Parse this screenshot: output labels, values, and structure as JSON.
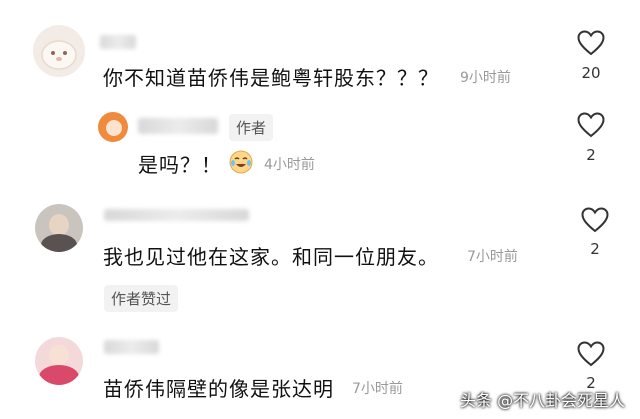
{
  "comments": [
    {
      "text": "你不知道苗侨伟是鲍粤轩股东？？？",
      "time": "9小时前",
      "likes": "20"
    },
    {
      "text": "我也见过他在这家。和同一位朋友。",
      "time": "7小时前",
      "likes": "2",
      "badge": "作者赞过"
    },
    {
      "text": "苗侨伟隔壁的像是张达明",
      "time": "7小时前",
      "likes": "2"
    }
  ],
  "reply": {
    "author_tag": "作者",
    "text": "是吗？！",
    "time": "4小时前",
    "likes": "2"
  },
  "watermark": {
    "text": "头条 @不八卦会死星人"
  },
  "icons": {
    "like": "heart-outline-icon",
    "emoji": "crying-laughing-emoji-icon"
  }
}
